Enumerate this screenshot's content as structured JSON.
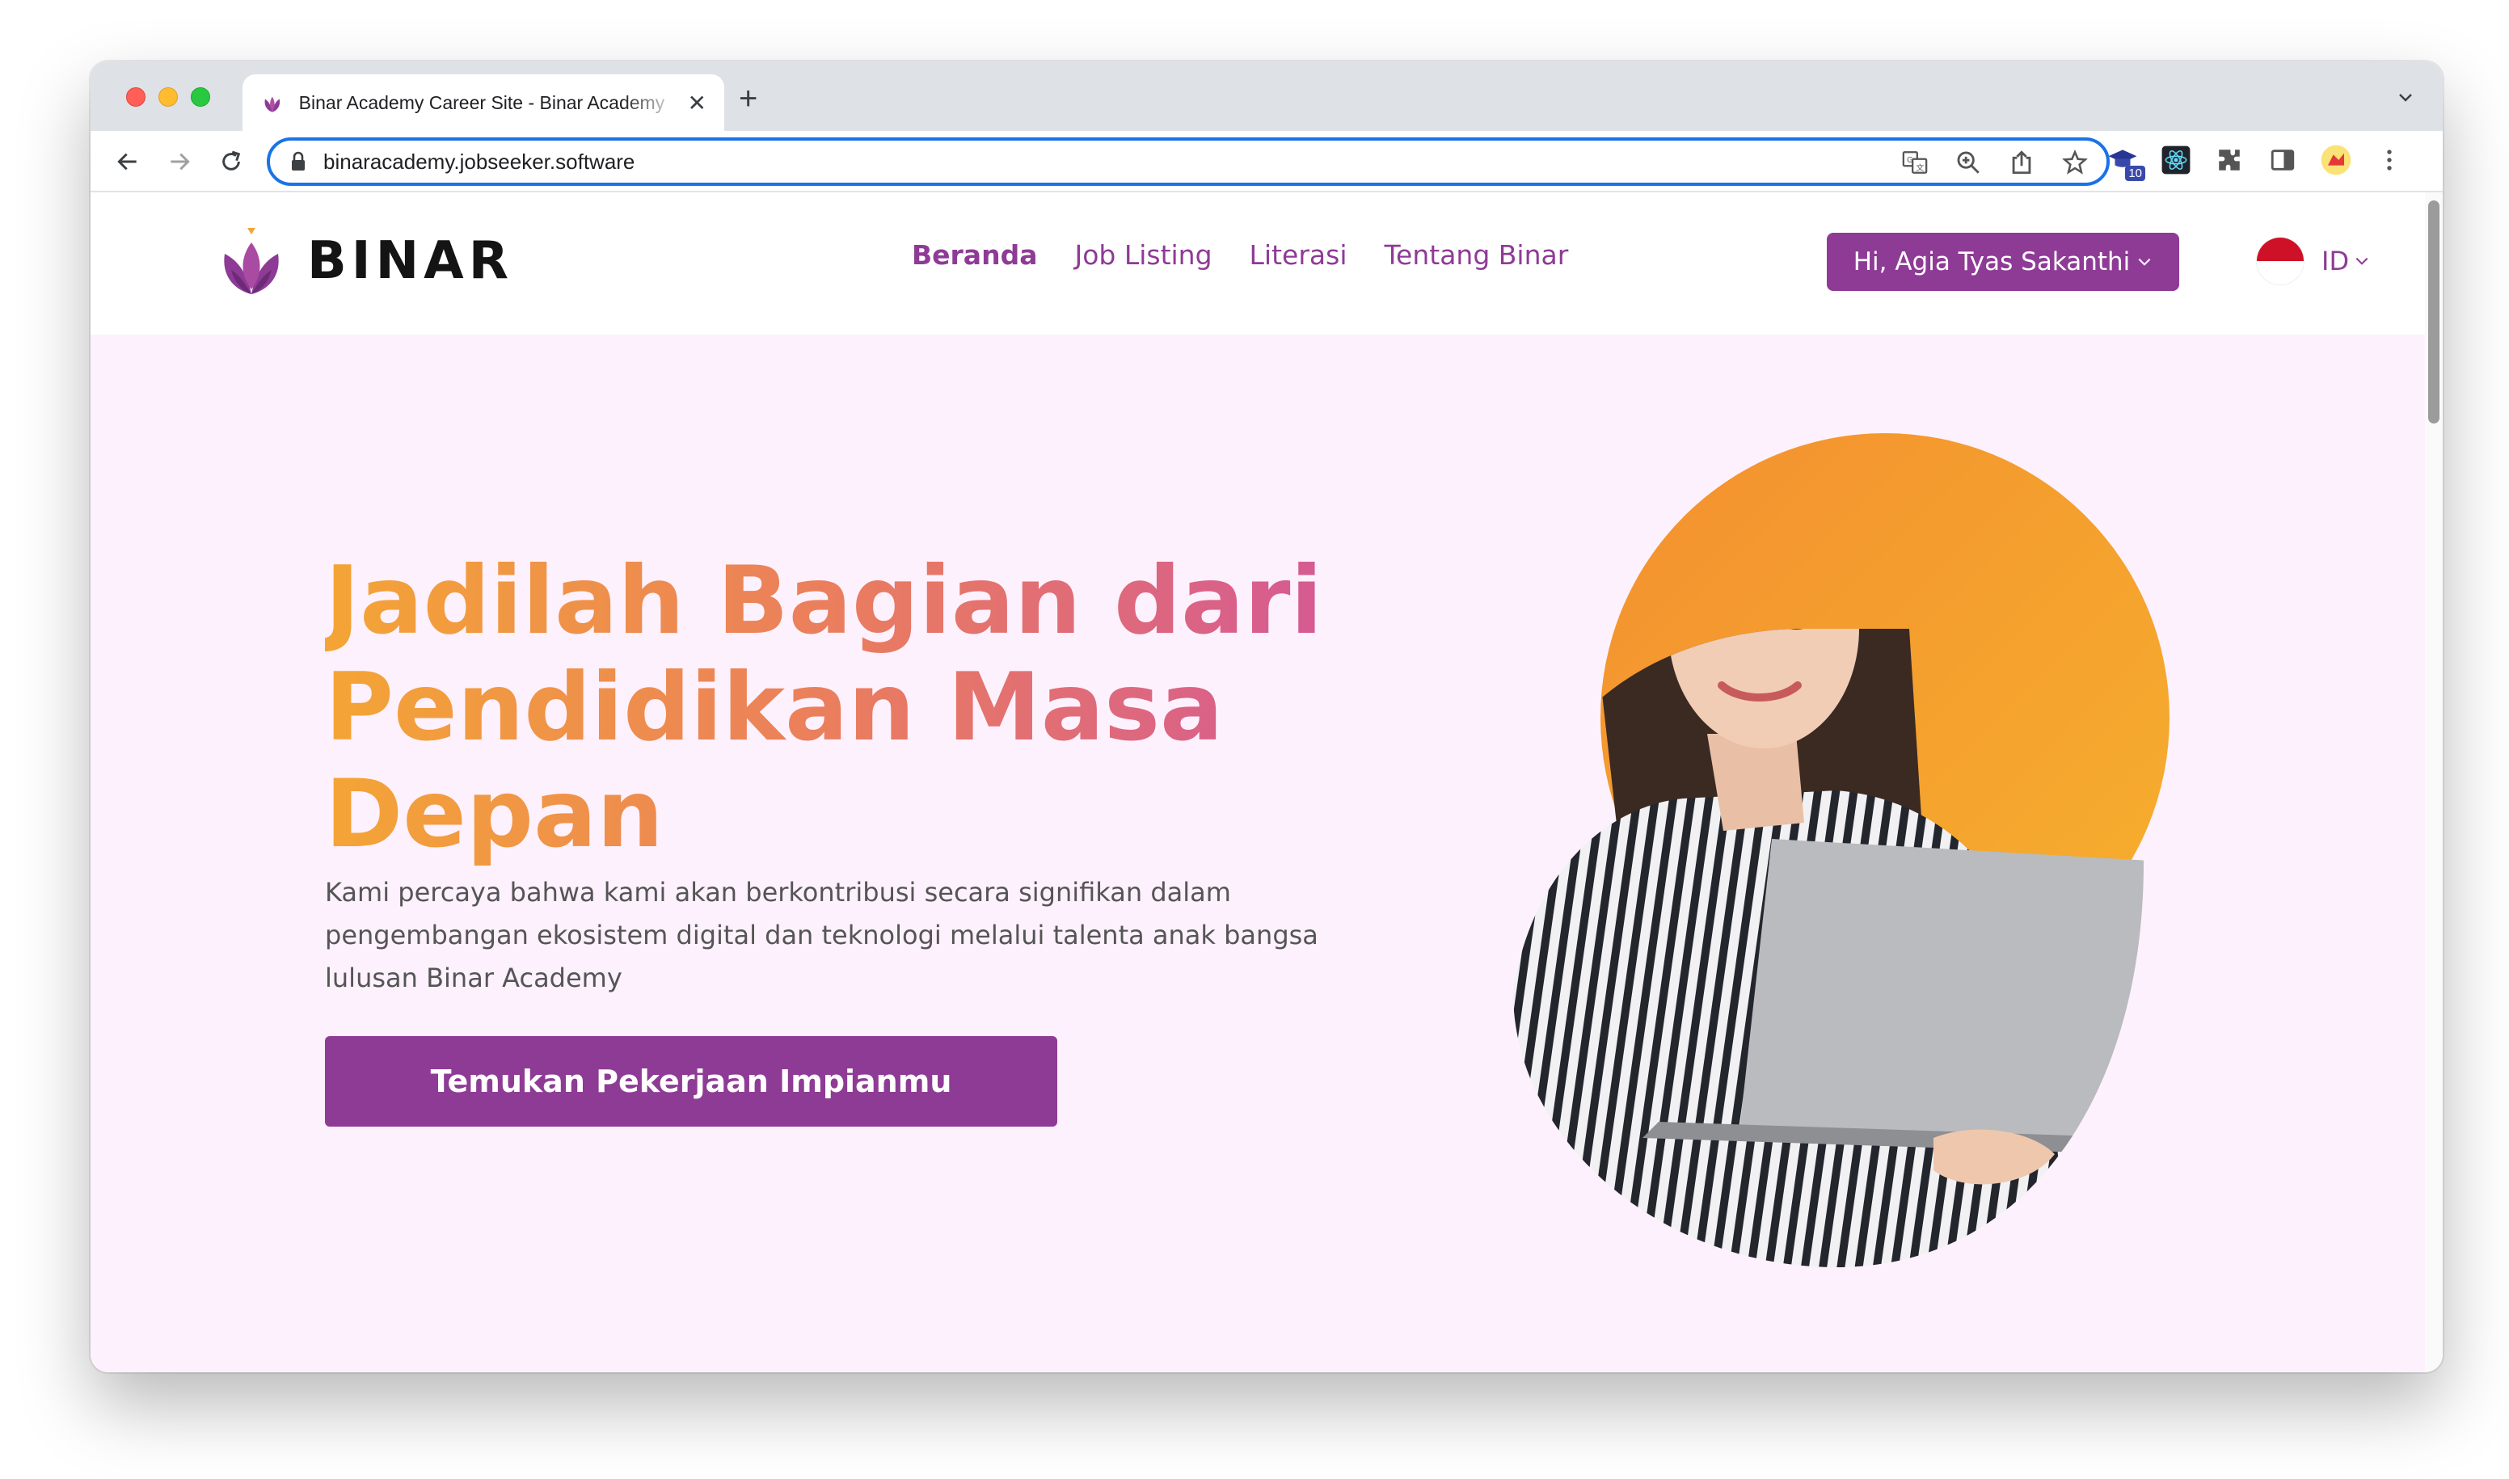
{
  "browser": {
    "tab_title": "Binar Academy Career Site - Binar Academy",
    "tab_close": "✕",
    "new_tab": "+",
    "url": "binaracademy.jobseeker.software",
    "extension_badge": "10"
  },
  "site": {
    "logo_text": "BINAR",
    "nav": [
      {
        "label": "Beranda",
        "active": true
      },
      {
        "label": "Job Listing",
        "active": false
      },
      {
        "label": "Literasi",
        "active": false
      },
      {
        "label": "Tentang Binar",
        "active": false
      }
    ],
    "user_button": "Hi, Agia Tyas Sakanthi",
    "language": "ID"
  },
  "hero": {
    "title_line1": "Jadilah Bagian dari",
    "title_line2": "Pendidikan Masa Depan",
    "description": "Kami percaya bahwa kami akan berkontribusi secara signifikan dalam pengembangan ekosistem digital dan teknologi melalui talenta anak bangsa lulusan Binar Academy",
    "cta_label": "Temukan Pekerjaan Impianmu"
  },
  "colors": {
    "brand_purple": "#8e3b96",
    "hero_bg": "#fdf1fd",
    "accent_orange": "#f4a535",
    "accent_pink": "#cf4fa3"
  }
}
